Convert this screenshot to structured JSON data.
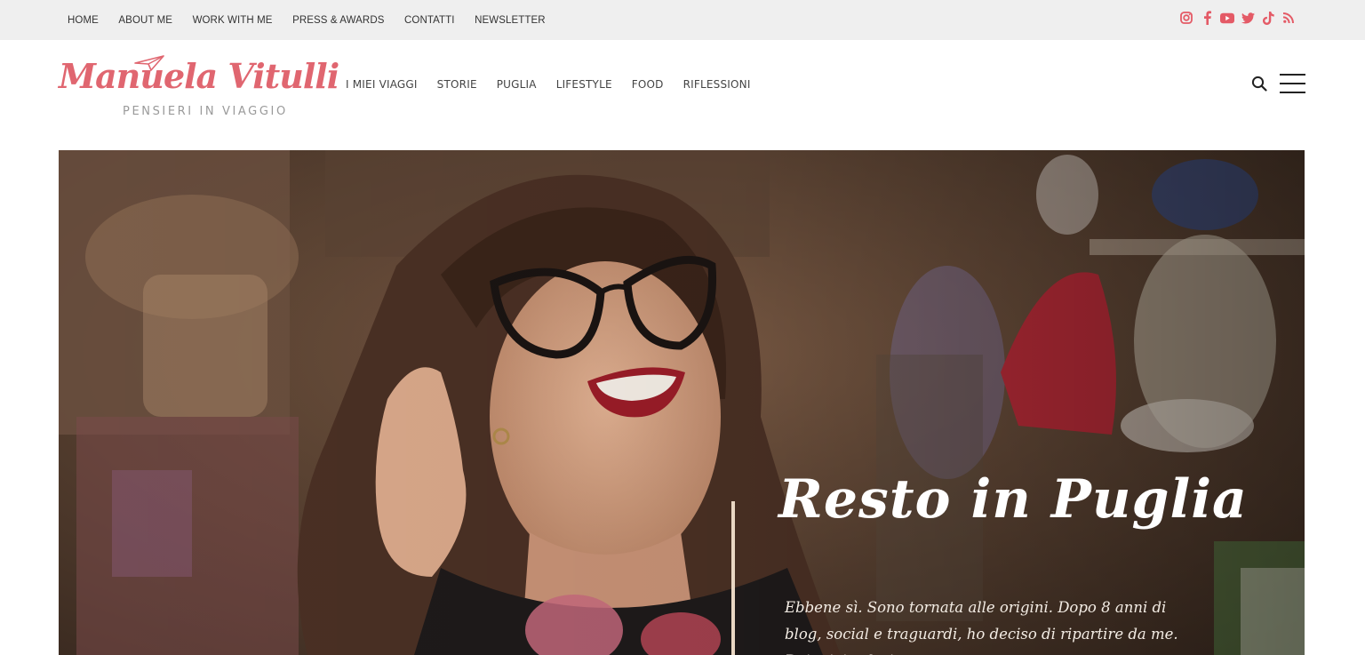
{
  "topbar": {
    "nav": [
      "HOME",
      "ABOUT ME",
      "WORK WITH ME",
      "PRESS & AWARDS",
      "CONTATTI",
      "NEWSLETTER"
    ],
    "social_icons": [
      "instagram-icon",
      "facebook-icon",
      "youtube-icon",
      "twitter-icon",
      "tiktok-icon",
      "rss-icon"
    ],
    "social_color": "#e45a66"
  },
  "header": {
    "logo_script": "Manuela Vitulli",
    "logo_tagline": "PENSIERI IN VIAGGIO",
    "logo_color": "#e06670",
    "nav": [
      "I MIEI VIAGGI",
      "STORIE",
      "PUGLIA",
      "LIFESTYLE",
      "FOOD",
      "RIFLESSIONI"
    ]
  },
  "hero": {
    "title": "Resto in Puglia",
    "excerpt": "Ebbene sì. Sono tornata alle origini. Dopo 8 anni di blog, social e traguardi, ho deciso di ripartire da me. Dai miei valori",
    "divider_color": "#e9d7c3"
  }
}
